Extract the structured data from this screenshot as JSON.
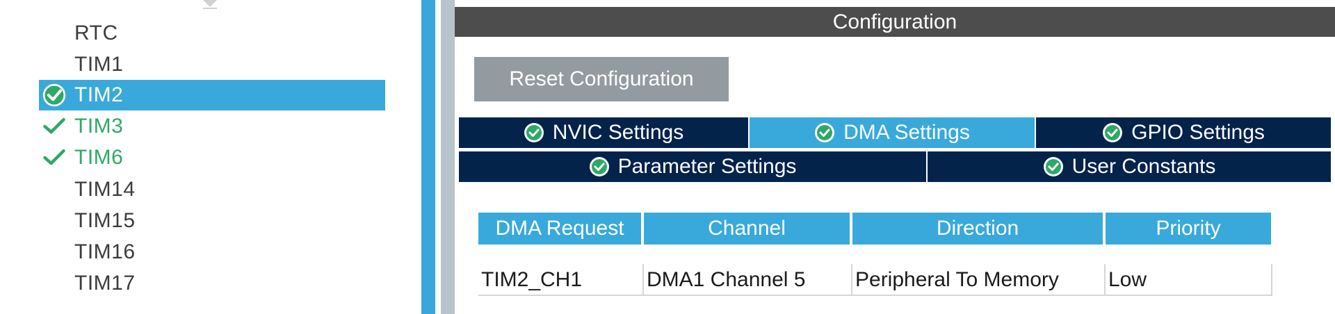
{
  "tree": {
    "items": [
      {
        "label": "RTC",
        "state": "normal"
      },
      {
        "label": "TIM1",
        "state": "normal"
      },
      {
        "label": "TIM2",
        "state": "selected"
      },
      {
        "label": "TIM3",
        "state": "ok"
      },
      {
        "label": "TIM6",
        "state": "ok"
      },
      {
        "label": "TIM14",
        "state": "normal"
      },
      {
        "label": "TIM15",
        "state": "normal"
      },
      {
        "label": "TIM16",
        "state": "normal"
      },
      {
        "label": "TIM17",
        "state": "normal"
      }
    ]
  },
  "config": {
    "title": "Configuration",
    "reset_label": "Reset Configuration",
    "tabs": [
      {
        "label": "NVIC Settings",
        "active": false
      },
      {
        "label": "DMA Settings",
        "active": true
      },
      {
        "label": "GPIO Settings",
        "active": false
      },
      {
        "label": "Parameter Settings",
        "active": false
      },
      {
        "label": "User Constants",
        "active": false
      }
    ],
    "table": {
      "headers": [
        "DMA Request",
        "Channel",
        "Direction",
        "Priority"
      ],
      "rows": [
        [
          "TIM2_CH1",
          "DMA1 Channel 5",
          "Peripheral To Memory",
          "Low"
        ]
      ]
    }
  },
  "colors": {
    "accent": "#39a9db",
    "tab_dark": "#03234b",
    "ok_green": "#2ea867",
    "header_gray": "#4d4d4d",
    "button_gray": "#939ba1"
  },
  "icons": {
    "check": "check-icon",
    "check_circle": "check-circle-icon"
  }
}
